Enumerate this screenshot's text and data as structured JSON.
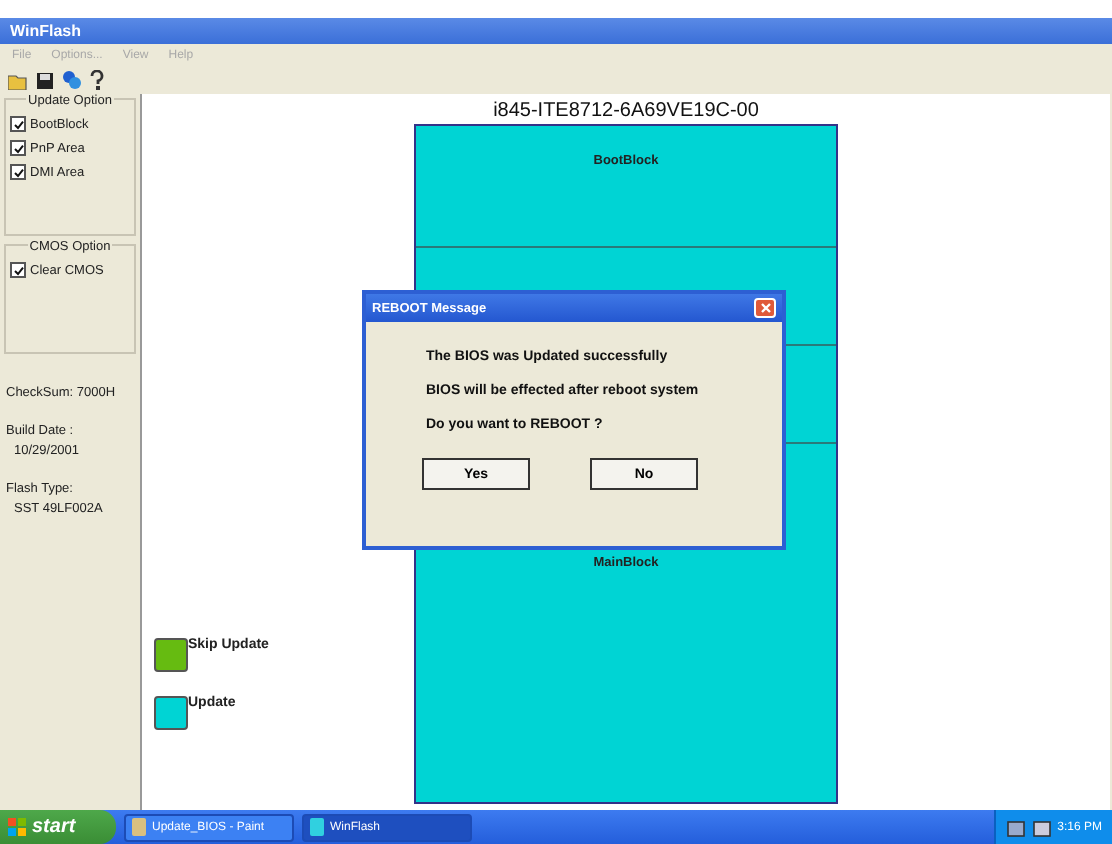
{
  "window": {
    "title": "WinFlash"
  },
  "menu": [
    "File",
    "Options...",
    "View",
    "Help"
  ],
  "update_option": {
    "title": "Update Option",
    "items": [
      {
        "label": "BootBlock",
        "checked": true
      },
      {
        "label": "PnP Area",
        "checked": true
      },
      {
        "label": "DMI Area",
        "checked": true
      }
    ]
  },
  "cmos_option": {
    "title": "CMOS Option",
    "items": [
      {
        "label": "Clear CMOS",
        "checked": true
      }
    ]
  },
  "info": {
    "checksum": "CheckSum:  7000H",
    "build_date_label": "Build Date :",
    "build_date": "10/29/2001",
    "flash_type_label": "Flash Type:",
    "flash_type": "SST 49LF002A"
  },
  "rom": {
    "title": "i845-ITE8712-6A69VE19C-00",
    "blocks": [
      {
        "label": "BootBlock",
        "color": "#00d4d4"
      },
      {
        "color": "#00d4d4"
      },
      {
        "color": "#00d4d4"
      },
      {
        "label": "MainBlock",
        "color": "#00d4d4"
      }
    ]
  },
  "legend": [
    {
      "label": "Skip Update",
      "color": "#66bb11"
    },
    {
      "label": "Update",
      "color": "#00d4d4"
    }
  ],
  "dialog": {
    "title": "REBOOT Message",
    "lines": [
      "The BIOS was Updated successfully",
      "BIOS will be effected after reboot system",
      "Do you want to REBOOT ?"
    ],
    "buttons": [
      "Yes",
      "No"
    ]
  },
  "taskbar": {
    "start": "start",
    "tasks": [
      {
        "label": "Update_BIOS - Paint",
        "selected": false
      },
      {
        "label": "WinFlash",
        "selected": true
      }
    ],
    "clock": "3:16 PM"
  }
}
